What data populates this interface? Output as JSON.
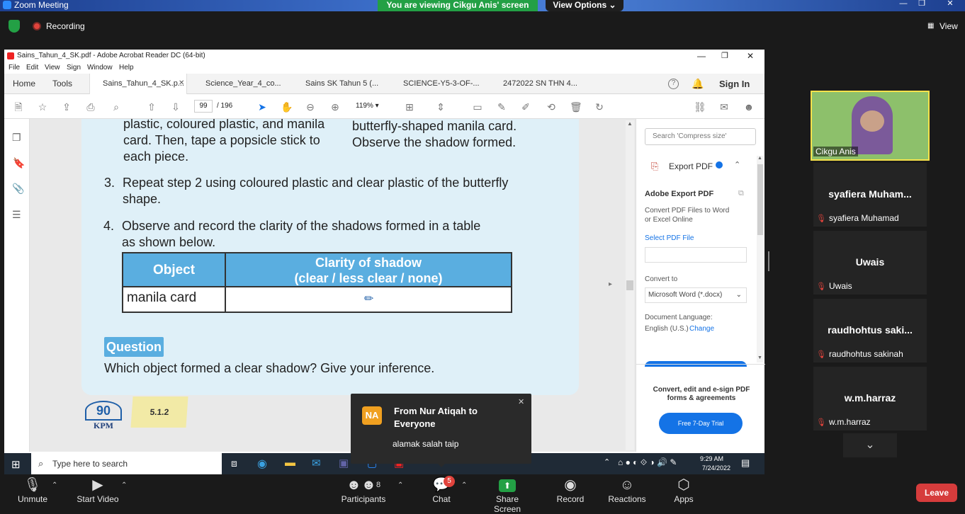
{
  "zoom": {
    "window_title": "Zoom Meeting",
    "share_banner": "You are viewing Cikgu Anis' screen",
    "view_options": "View Options",
    "recording_label": "Recording",
    "view_label": "View"
  },
  "acrobat": {
    "window_title": "Sains_Tahun_4_SK.pdf - Adobe Acrobat Reader DC (64-bit)",
    "menu": [
      "File",
      "Edit",
      "View",
      "Sign",
      "Window",
      "Help"
    ],
    "home": "Home",
    "tools": "Tools",
    "tabs": [
      "Sains_Tahun_4_SK.p...",
      "Science_Year_4_co...",
      "Sains SK Tahun 5 (...",
      "SCIENCE-Y5-3-OF-...",
      "2472022 SN THN 4..."
    ],
    "sign_in": "Sign In",
    "page_current": "99",
    "page_total": "/ 196",
    "zoom_level": "119%",
    "right_panel": {
      "search_placeholder": "Search 'Compress size'",
      "export_title": "Export PDF",
      "adobe_export_heading": "Adobe Export PDF",
      "export_desc": "Convert PDF Files to Word or Excel Online",
      "select_file": "Select PDF File",
      "convert_to_label": "Convert to",
      "convert_to_value": "Microsoft Word (*.docx)",
      "doc_language_label": "Document Language:",
      "doc_language_value": "English (U.S.)",
      "change": "Change",
      "promo": "Convert, edit and e-sign PDF forms & agreements",
      "trial_button": "Free 7-Day Trial"
    }
  },
  "document": {
    "step2_left": [
      "plastic, coloured plastic, and manila",
      "card. Then, tape a popsicle stick to",
      "each piece."
    ],
    "step2_right": [
      "butterfly-shaped manila card.",
      "Observe the shadow formed."
    ],
    "step3_num": "3.",
    "step3": [
      "Repeat step 2 using coloured plastic and clear plastic of the butterfly",
      "shape."
    ],
    "step4_num": "4.",
    "step4": [
      "Observe and record the clarity of the shadows formed in a table",
      "as shown below."
    ],
    "table_header_1": "Object",
    "table_header_2a": "Clarity of shadow",
    "table_header_2b": "(clear / less clear / none)",
    "table_cell": "manila card",
    "question_label": "Question",
    "question_text": "Which object formed a clear shadow? Give your inference.",
    "page_number": "90",
    "kpm": "KPM",
    "section_code": "5.1.2"
  },
  "taskbar": {
    "search_placeholder": "Type here to search",
    "time": "9:29 AM",
    "date": "7/24/2022"
  },
  "toast": {
    "initials": "NA",
    "from": "From Nur Atiqah to Everyone",
    "message": "alamak salah taip"
  },
  "participants_panel": {
    "presenter": "Cikgu Anis",
    "tiles": [
      {
        "title": "syafiera  Muham...",
        "label": "syafiera Muhamad"
      },
      {
        "title": "Uwais",
        "label": "Uwais"
      },
      {
        "title": "raudhohtus  saki...",
        "label": "raudhohtus sakinah"
      },
      {
        "title": "w.m.harraz",
        "label": "w.m.harraz"
      }
    ]
  },
  "toolbar": {
    "unmute": "Unmute",
    "start_video": "Start Video",
    "participants": "Participants",
    "participants_count": "8",
    "chat": "Chat",
    "chat_badge": "5",
    "share_screen": "Share Screen",
    "record": "Record",
    "reactions": "Reactions",
    "apps": "Apps",
    "leave": "Leave"
  },
  "colors": {
    "accent_green": "#23a045",
    "leave_red": "#d63c3c",
    "table_header_blue": "#5aaee0",
    "adobe_blue": "#1473e6"
  }
}
